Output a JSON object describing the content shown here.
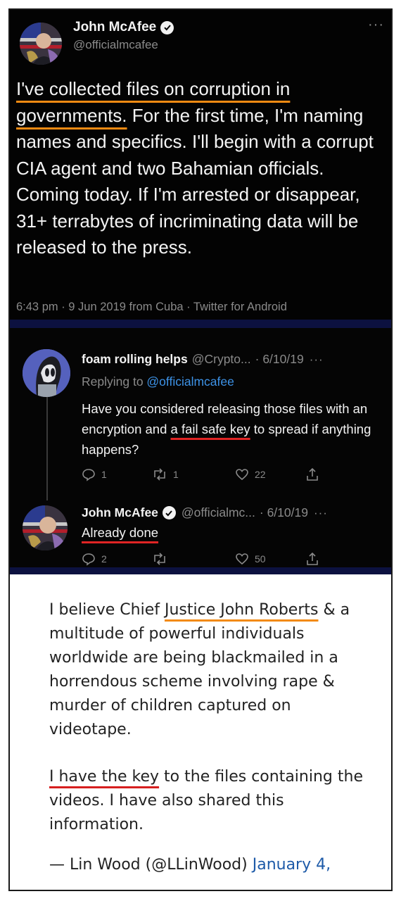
{
  "tweet": {
    "author_name": "John McAfee",
    "author_handle": "@officialmcafee",
    "text_highlight": "I've collected files on corruption in governments.",
    "text_rest": " For the first time, I'm naming names and specifics. I'll begin with a corrupt CIA agent and two Bahamian officials. Coming today. If I'm arrested or disappear, 31+ terrabytes of incriminating data will be released to the press.",
    "meta": "6:43 pm · 9 Jun 2019 from Cuba · Twitter for Android",
    "more_label": "···"
  },
  "reply1": {
    "name": "foam rolling helps",
    "handle": "@Crypto...",
    "date": "· 6/10/19",
    "more_label": "···",
    "replying_prefix": "Replying to ",
    "replying_mention": "@officialmcafee",
    "body_before": "Have you considered releasing those files with an encryption and ",
    "body_highlight": "a fail safe key",
    "body_after": " to spread if anything happens?",
    "replies": "1",
    "retweets": "1",
    "likes": "22"
  },
  "reply2": {
    "name": "John McAfee",
    "handle": "@officialmc...",
    "date": "· 6/10/19",
    "more_label": "···",
    "body": "Already done",
    "replies": "2",
    "retweets": "",
    "likes": "50"
  },
  "quote": {
    "p1_before": "I believe Chief ",
    "p1_highlight": "Justice John Roberts",
    "p1_after": " & a multitude of powerful individuals worldwide are being blackmailed in a horrendous scheme involving rape & murder of children captured on videotape.",
    "p2_highlight": "I have the key",
    "p2_after": " to the files containing the videos. I have also shared this information.",
    "signature": "— Lin Wood (@LLinWood) ",
    "signature_date": "January 4,"
  },
  "colors": {
    "highlight_orange": "#f28a12",
    "highlight_red": "#e02424",
    "mention_blue": "#3d92e6",
    "band_navy": "#0c1140"
  }
}
